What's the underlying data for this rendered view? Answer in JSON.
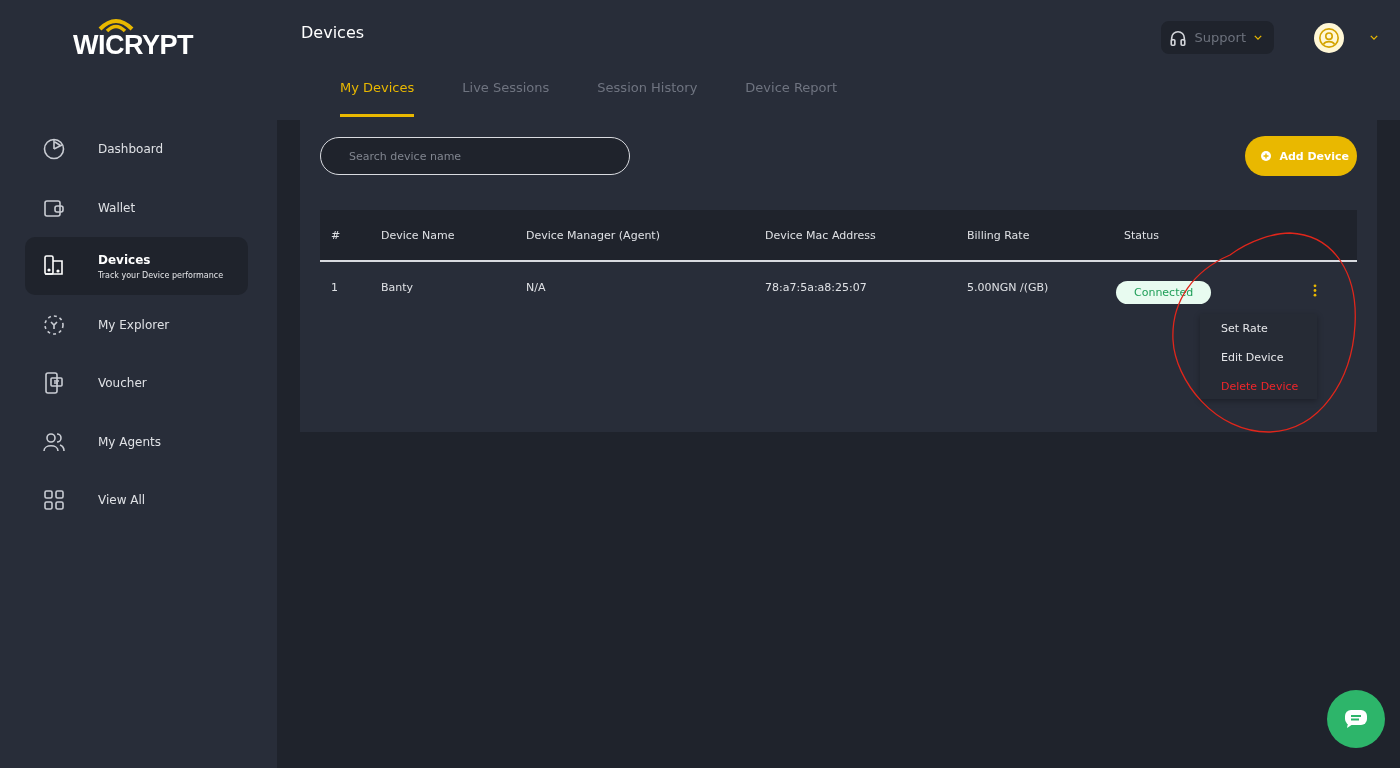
{
  "logo": "WICRYPT",
  "header": {
    "title": "Devices",
    "support": "Support"
  },
  "sidebar": {
    "items": [
      {
        "label": "Dashboard",
        "selected": false
      },
      {
        "label": "Wallet",
        "selected": false
      },
      {
        "label": "Devices",
        "subtitle": "Track your Device performance",
        "selected": true
      },
      {
        "label": "My Explorer",
        "selected": false
      },
      {
        "label": "Voucher",
        "selected": false
      },
      {
        "label": "My Agents",
        "selected": false
      },
      {
        "label": "View All",
        "selected": false
      }
    ]
  },
  "tabs": [
    {
      "label": "My Devices",
      "selected": true
    },
    {
      "label": "Live Sessions",
      "selected": false
    },
    {
      "label": "Session History",
      "selected": false
    },
    {
      "label": "Device Report",
      "selected": false
    }
  ],
  "search": {
    "placeholder": "Search device name"
  },
  "add_button": "Add Device",
  "table": {
    "columns": [
      "#",
      "Device Name",
      "Device Manager (Agent)",
      "Device Mac Address",
      "Billing Rate",
      "Status"
    ],
    "rows": [
      {
        "cells": [
          "1",
          "Banty",
          "N/A",
          "78:a7:5a:a8:25:07",
          "5.00NGN /(GB)"
        ],
        "status": "Connected"
      }
    ]
  },
  "row_menu": [
    {
      "label": "Set Rate",
      "kind": "normal"
    },
    {
      "label": "Edit Device",
      "kind": "normal"
    },
    {
      "label": "Delete Device",
      "kind": "danger"
    }
  ]
}
